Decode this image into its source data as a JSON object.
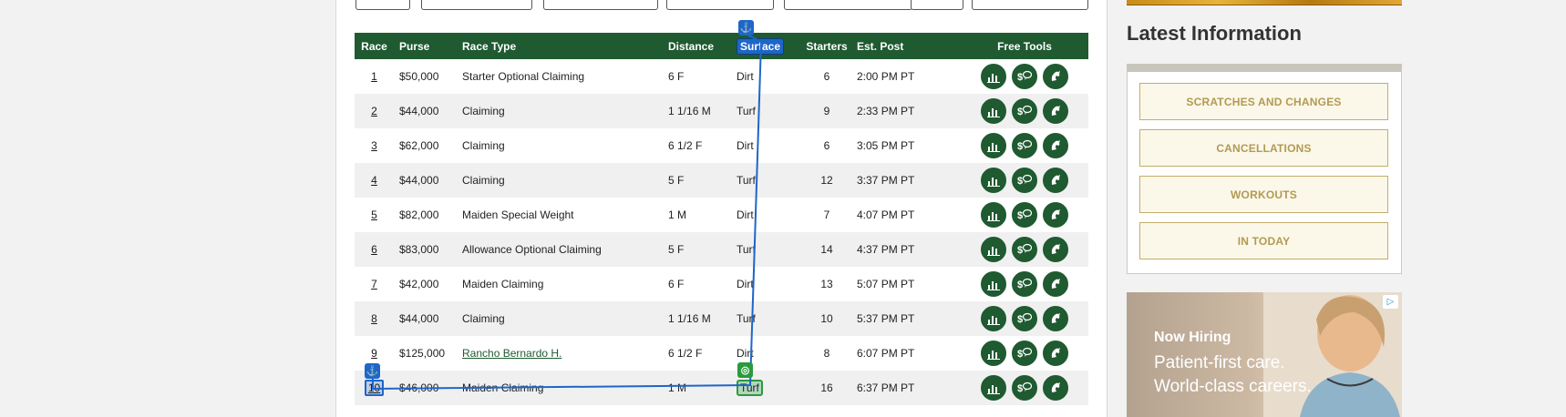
{
  "table": {
    "headers": {
      "race": "Race",
      "purse": "Purse",
      "race_type": "Race Type",
      "distance": "Distance",
      "surface": "Surface",
      "starters": "Starters",
      "est_post": "Est. Post",
      "free_tools": "Free Tools"
    },
    "rows": [
      {
        "race": "1",
        "purse": "$50,000",
        "race_type": "Starter Optional Claiming",
        "distance": "6 F",
        "surface": "Dirt",
        "starters": "6",
        "est_post": "2:00 PM PT"
      },
      {
        "race": "2",
        "purse": "$44,000",
        "race_type": "Claiming",
        "distance": "1 1/16 M",
        "surface": "Turf",
        "starters": "9",
        "est_post": "2:33 PM PT"
      },
      {
        "race": "3",
        "purse": "$62,000",
        "race_type": "Claiming",
        "distance": "6 1/2 F",
        "surface": "Dirt",
        "starters": "6",
        "est_post": "3:05 PM PT"
      },
      {
        "race": "4",
        "purse": "$44,000",
        "race_type": "Claiming",
        "distance": "5 F",
        "surface": "Turf",
        "starters": "12",
        "est_post": "3:37 PM PT"
      },
      {
        "race": "5",
        "purse": "$82,000",
        "race_type": "Maiden Special Weight",
        "distance": "1 M",
        "surface": "Dirt",
        "starters": "7",
        "est_post": "4:07 PM PT"
      },
      {
        "race": "6",
        "purse": "$83,000",
        "race_type": "Allowance Optional Claiming",
        "distance": "5 F",
        "surface": "Turf",
        "starters": "14",
        "est_post": "4:37 PM PT"
      },
      {
        "race": "7",
        "purse": "$42,000",
        "race_type": "Maiden Claiming",
        "distance": "6 F",
        "surface": "Dirt",
        "starters": "13",
        "est_post": "5:07 PM PT"
      },
      {
        "race": "8",
        "purse": "$44,000",
        "race_type": "Claiming",
        "distance": "1 1/16 M",
        "surface": "Turf",
        "starters": "10",
        "est_post": "5:37 PM PT"
      },
      {
        "race": "9",
        "purse": "$125,000",
        "race_type": "Rancho Bernardo H.",
        "distance": "6 1/2 F",
        "surface": "Dirt",
        "starters": "8",
        "est_post": "6:07 PM PT"
      },
      {
        "race": "10",
        "purse": "$46,000",
        "race_type": "Maiden Claiming",
        "distance": "1 M",
        "surface": "Turf",
        "starters": "16",
        "est_post": "6:37 PM PT"
      }
    ],
    "tool_icons": [
      "bar-chart-icon",
      "dollar-speech-icon",
      "horse-icon"
    ]
  },
  "sidebar": {
    "title": "Latest Information",
    "buttons": [
      "SCRATCHES AND CHANGES",
      "CANCELLATIONS",
      "WORKOUTS",
      "IN TODAY"
    ]
  },
  "ad": {
    "heading": "Now Hiring",
    "line1": "Patient-first care.",
    "line2": "World-class careers."
  },
  "colors": {
    "header_green": "#1f5a30",
    "button_gold": "#b39a50",
    "annotation_blue": "#1e66c9",
    "annotation_green": "#2b9a3c"
  }
}
